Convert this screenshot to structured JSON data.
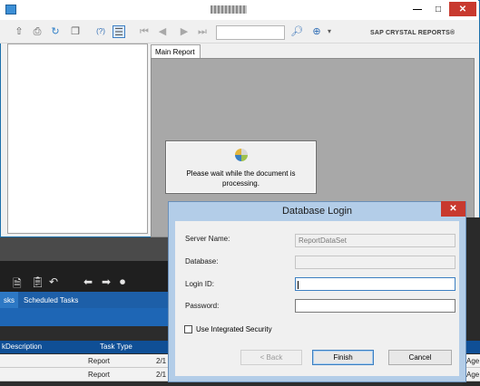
{
  "crystal": {
    "brand": "SAP CRYSTAL REPORTS®",
    "tab_label": "Main Report",
    "wait_message": "Please wait while the document is processing.",
    "window_controls": {
      "minimize": "—",
      "maximize": "□",
      "close": "✕"
    },
    "toolbar_icons": [
      "export-icon",
      "print-icon",
      "refresh-icon",
      "copy-icon",
      "help-icon",
      "toggle-group-tree-icon",
      "first-page-icon",
      "previous-page-icon",
      "next-page-icon",
      "last-page-icon",
      "find-icon",
      "zoom-icon"
    ]
  },
  "background_app": {
    "tabs": [
      "sks",
      "Scheduled Tasks"
    ],
    "columns": [
      "kDescription",
      "Task Type"
    ],
    "rows": [
      {
        "type": "Report",
        "date": "2/1",
        "extra": "Age"
      },
      {
        "type": "Report",
        "date": "2/1",
        "extra": "Age"
      }
    ]
  },
  "login": {
    "title": "Database Login",
    "close": "✕",
    "server_label": "Server Name:",
    "server_value": "ReportDataSet",
    "database_label": "Database:",
    "database_value": "",
    "loginid_label": "Login ID:",
    "loginid_value": "",
    "password_label": "Password:",
    "password_value": "",
    "integrated_label": "Use Integrated Security",
    "integrated_checked": false,
    "back_label": "< Back",
    "finish_label": "Finish",
    "cancel_label": "Cancel"
  },
  "colors": {
    "accent": "#3c7fc1",
    "dialog_frame": "#b3cde8",
    "close": "#c8392e",
    "header_blue": "#0f4f96"
  }
}
